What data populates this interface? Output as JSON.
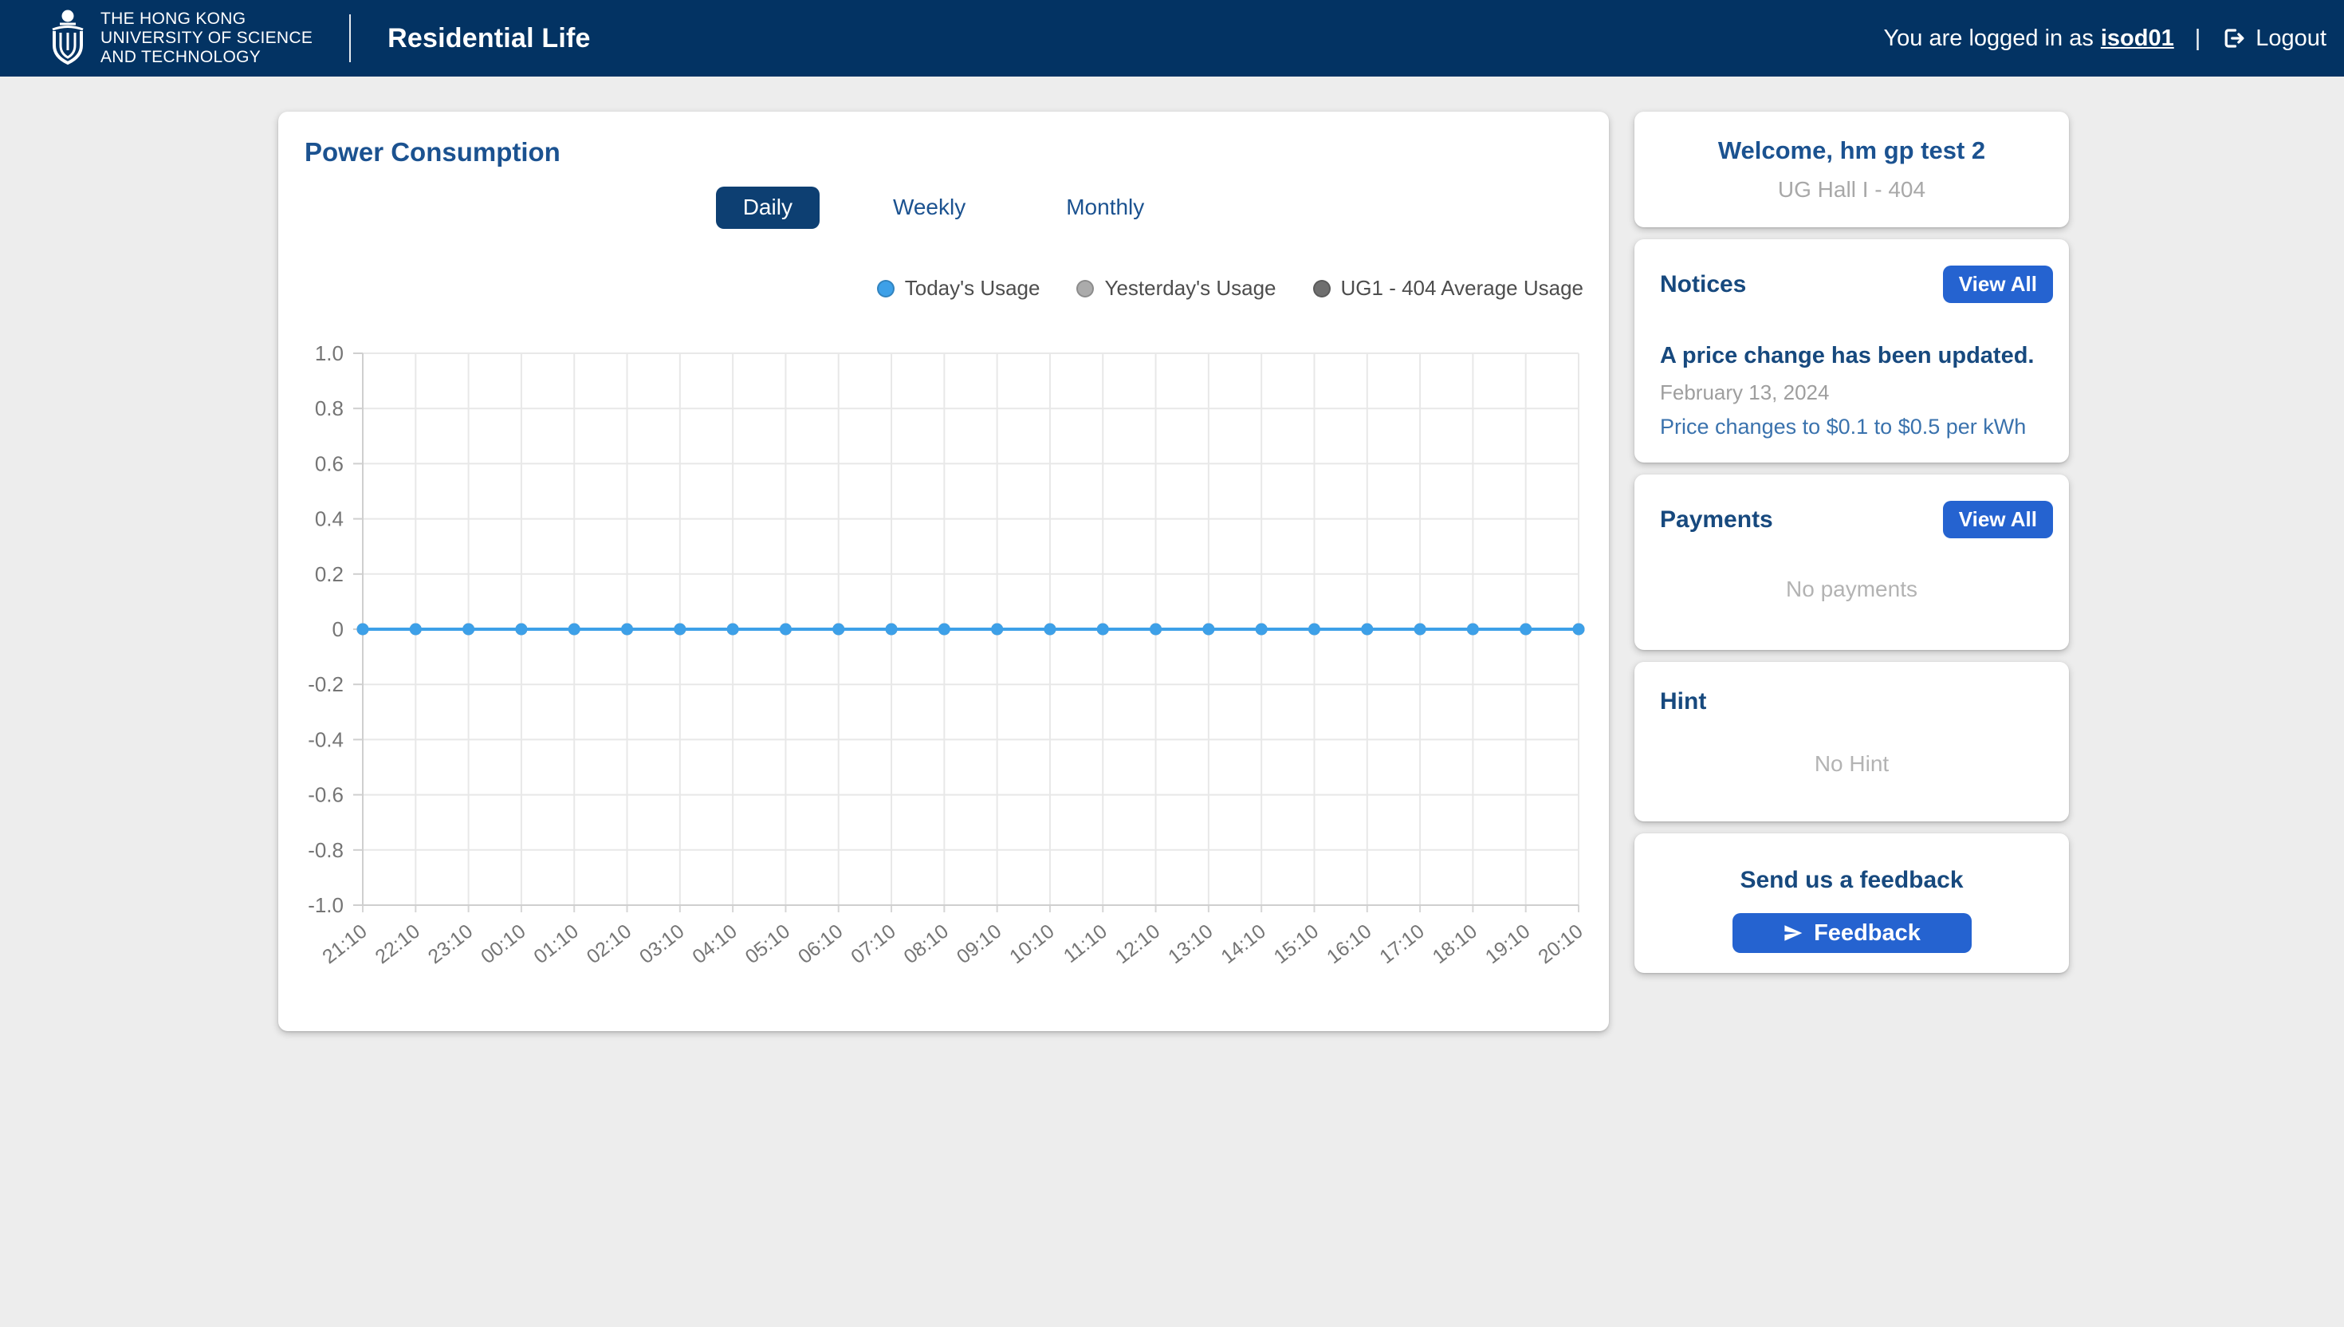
{
  "colors": {
    "navbar_bg": "#033363",
    "selected_tab_bg": "#0d3f72",
    "heading_blue": "#17497e",
    "title_blue": "#1b5290",
    "button_blue": "#2563d0",
    "link_blue": "#3a72ad",
    "line_blue": "#3da0e8",
    "page_bg": "#ededed"
  },
  "navbar": {
    "logo_lines": [
      "THE HONG KONG",
      "UNIVERSITY OF SCIENCE",
      "AND TECHNOLOGY"
    ],
    "app_title": "Residential Life",
    "login_prefix": "You are logged in as",
    "username": "isod01",
    "separator": "|",
    "logout_label": "Logout"
  },
  "chart_card": {
    "title": "Power Consumption",
    "tabs": [
      {
        "label": "Daily",
        "selected": true
      },
      {
        "label": "Weekly",
        "selected": false
      },
      {
        "label": "Monthly",
        "selected": false
      }
    ],
    "legend": [
      {
        "label": "Today's Usage",
        "color": "#3da0e8"
      },
      {
        "label": "Yesterday's Usage",
        "color": "#ababab"
      },
      {
        "label": "UG1 - 404 Average Usage",
        "color": "#6f6f6f"
      }
    ]
  },
  "chart_data": {
    "type": "line",
    "title": "Power Consumption",
    "x": [
      "21:10",
      "22:10",
      "23:10",
      "00:10",
      "01:10",
      "02:10",
      "03:10",
      "04:10",
      "05:10",
      "06:10",
      "07:10",
      "08:10",
      "09:10",
      "10:10",
      "11:10",
      "12:10",
      "13:10",
      "14:10",
      "15:10",
      "16:10",
      "17:10",
      "18:10",
      "19:10",
      "20:10"
    ],
    "series": [
      {
        "name": "Today's Usage",
        "color": "#3da0e8",
        "values": [
          0,
          0,
          0,
          0,
          0,
          0,
          0,
          0,
          0,
          0,
          0,
          0,
          0,
          0,
          0,
          0,
          0,
          0,
          0,
          0,
          0,
          0,
          0,
          0
        ]
      },
      {
        "name": "Yesterday's Usage",
        "color": "#ababab",
        "values": [
          0,
          0,
          0,
          0,
          0,
          0,
          0,
          0,
          0,
          0,
          0,
          0,
          0,
          0,
          0,
          0,
          0,
          0,
          0,
          0,
          0,
          0,
          0,
          0
        ]
      },
      {
        "name": "UG1 - 404 Average Usage",
        "color": "#6f6f6f",
        "values": [
          0,
          0,
          0,
          0,
          0,
          0,
          0,
          0,
          0,
          0,
          0,
          0,
          0,
          0,
          0,
          0,
          0,
          0,
          0,
          0,
          0,
          0,
          0,
          0
        ]
      }
    ],
    "ylim": [
      -1,
      1
    ],
    "ytick_step": 0.2,
    "ytick_labels": [
      "1.0",
      "0.8",
      "0.6",
      "0.4",
      "0.2",
      "0",
      "-0.2",
      "-0.4",
      "-0.6",
      "-0.8",
      "-1.0"
    ],
    "grid": true,
    "legend_position": "top-right"
  },
  "sidebar": {
    "welcome": {
      "title": "Welcome, hm gp test 2",
      "subtitle": "UG Hall I - 404"
    },
    "notices": {
      "title": "Notices",
      "view_all_label": "View All",
      "items": [
        {
          "title": "A price change has been updated.",
          "date": "February 13, 2024",
          "link": "Price changes to $0.1 to $0.5 per kWh"
        }
      ]
    },
    "payments": {
      "title": "Payments",
      "view_all_label": "View All",
      "empty": "No payments"
    },
    "hint": {
      "title": "Hint",
      "empty": "No Hint"
    },
    "feedback": {
      "title": "Send us a feedback",
      "button_label": "Feedback"
    }
  }
}
